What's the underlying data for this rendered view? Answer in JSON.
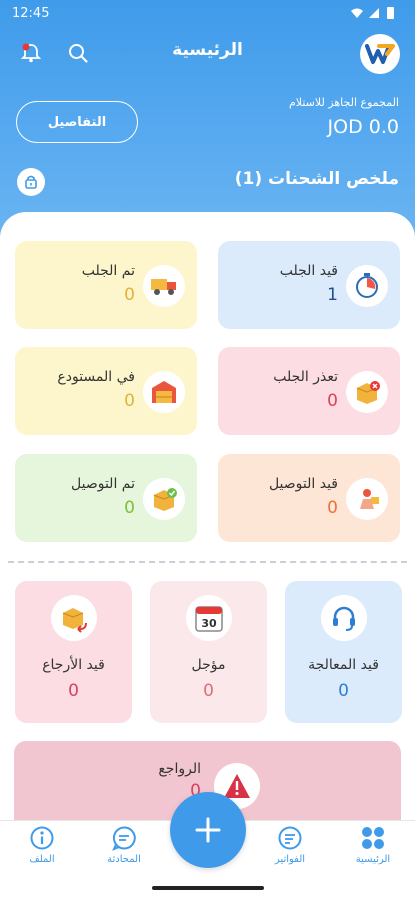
{
  "status_bar": {
    "time": "12:45"
  },
  "header": {
    "title": "الرئيسية",
    "balance_label": "المجموع الجاهز للاستلام",
    "balance_value": "JOD 0.0",
    "details_button": "التفاصيل",
    "summary_title": "ملخص الشحنات (1)"
  },
  "colors": {
    "primary": "#3f9bea",
    "blue_card": "#dcebfb",
    "yellow_card": "#fdf6cc",
    "pink_card": "#fbdde3",
    "green_card": "#e5f6dc",
    "orange_card": "#fde6d6"
  },
  "cards": [
    {
      "label": "قيد الجلب",
      "value": "1",
      "icon": "stopwatch-icon"
    },
    {
      "label": "تم الجلب",
      "value": "0",
      "icon": "delivery-truck-icon"
    },
    {
      "label": "تعذر الجلب",
      "value": "0",
      "icon": "box-error-icon"
    },
    {
      "label": "في المستودع",
      "value": "0",
      "icon": "warehouse-icon"
    },
    {
      "label": "قيد التوصيل",
      "value": "0",
      "icon": "courier-icon"
    },
    {
      "label": "تم التوصيل",
      "value": "0",
      "icon": "box-check-icon"
    }
  ],
  "tall_cards": [
    {
      "label": "قيد المعالجة",
      "value": "0",
      "icon": "headset-icon"
    },
    {
      "label": "مؤجل",
      "value": "0",
      "icon": "calendar-icon",
      "calendar_day": "30"
    },
    {
      "label": "قيد الأرجاع",
      "value": "0",
      "icon": "box-return-icon"
    }
  ],
  "returns": {
    "label": "الرواجع",
    "value": "0",
    "icon": "warning-icon"
  },
  "nav": {
    "home": "الرئيسية",
    "invoices": "الفواتير",
    "chat": "المحادثة",
    "profile": "الملف"
  }
}
